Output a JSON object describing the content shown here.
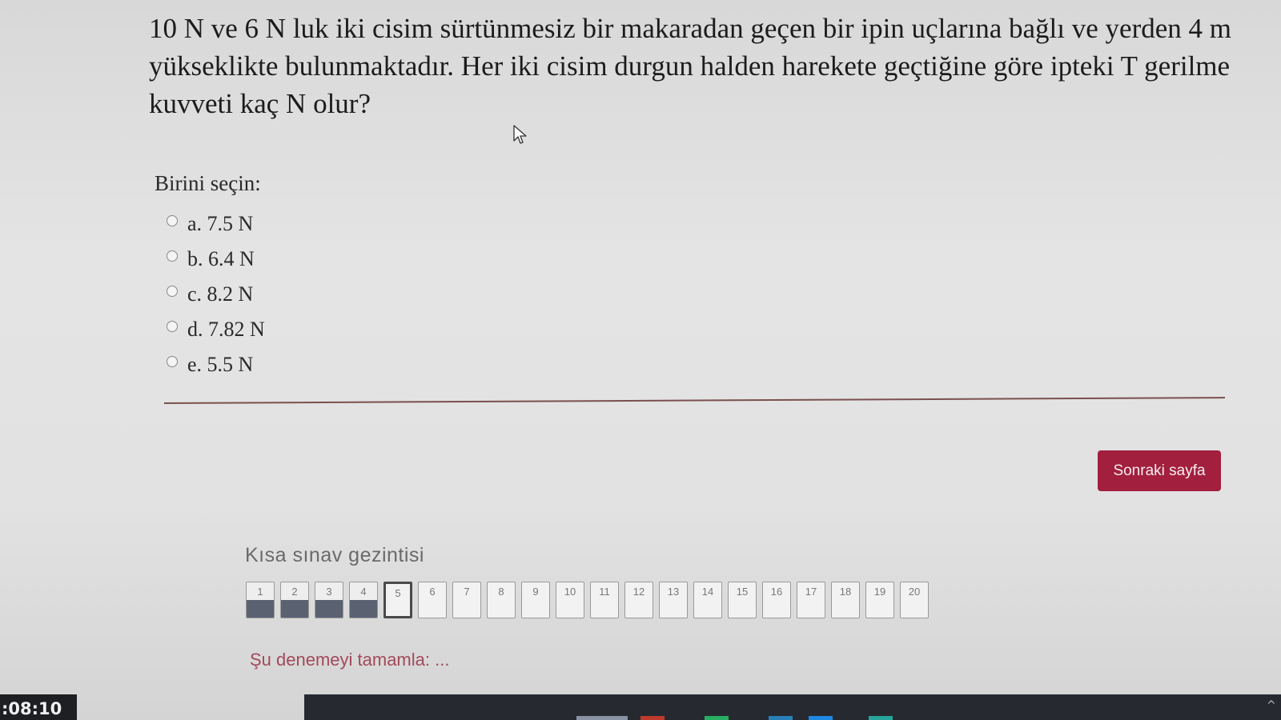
{
  "question": {
    "text": "10 N ve 6 N luk iki cisim sürtünmesiz bir makaradan geçen bir ipin uçlarına bağlı ve yerden 4 m yükseklikte bulunmaktadır. Her iki cisim durgun halden harekete geçtiğine göre ipteki T gerilme kuvveti kaç N olur?"
  },
  "answers": {
    "prompt": "Birini seçin:",
    "options": [
      {
        "label": "a. 7.5 N",
        "selected": false
      },
      {
        "label": "b. 6.4 N",
        "selected": false
      },
      {
        "label": "c. 8.2 N",
        "selected": false
      },
      {
        "label": "d. 7.82 N",
        "selected": false
      },
      {
        "label": "e. 5.5 N",
        "selected": false
      }
    ]
  },
  "next_button": {
    "label": "Sonraki sayfa",
    "color": "#a21f3e"
  },
  "quiz_nav": {
    "title": "Kısa sınav gezintisi",
    "current": 5,
    "buttons": [
      {
        "number": "1",
        "answered": true
      },
      {
        "number": "2",
        "answered": true
      },
      {
        "number": "3",
        "answered": true
      },
      {
        "number": "4",
        "answered": true
      },
      {
        "number": "5",
        "answered": false
      },
      {
        "number": "6",
        "answered": false
      },
      {
        "number": "7",
        "answered": false
      },
      {
        "number": "8",
        "answered": false
      },
      {
        "number": "9",
        "answered": false
      },
      {
        "number": "10",
        "answered": false
      },
      {
        "number": "11",
        "answered": false
      },
      {
        "number": "12",
        "answered": false
      },
      {
        "number": "13",
        "answered": false
      },
      {
        "number": "14",
        "answered": false
      },
      {
        "number": "15",
        "answered": false
      },
      {
        "number": "16",
        "answered": false
      },
      {
        "number": "17",
        "answered": false
      },
      {
        "number": "18",
        "answered": false
      },
      {
        "number": "19",
        "answered": false
      },
      {
        "number": "20",
        "answered": false
      }
    ],
    "finish_link": "Şu denemeyi tamamla: ..."
  },
  "taskbar": {
    "clock": ":08:10"
  },
  "icons": {
    "cursor": "mouse-pointer-icon",
    "radio": "radio-button-icon",
    "tray": "chevron-up-icon"
  }
}
